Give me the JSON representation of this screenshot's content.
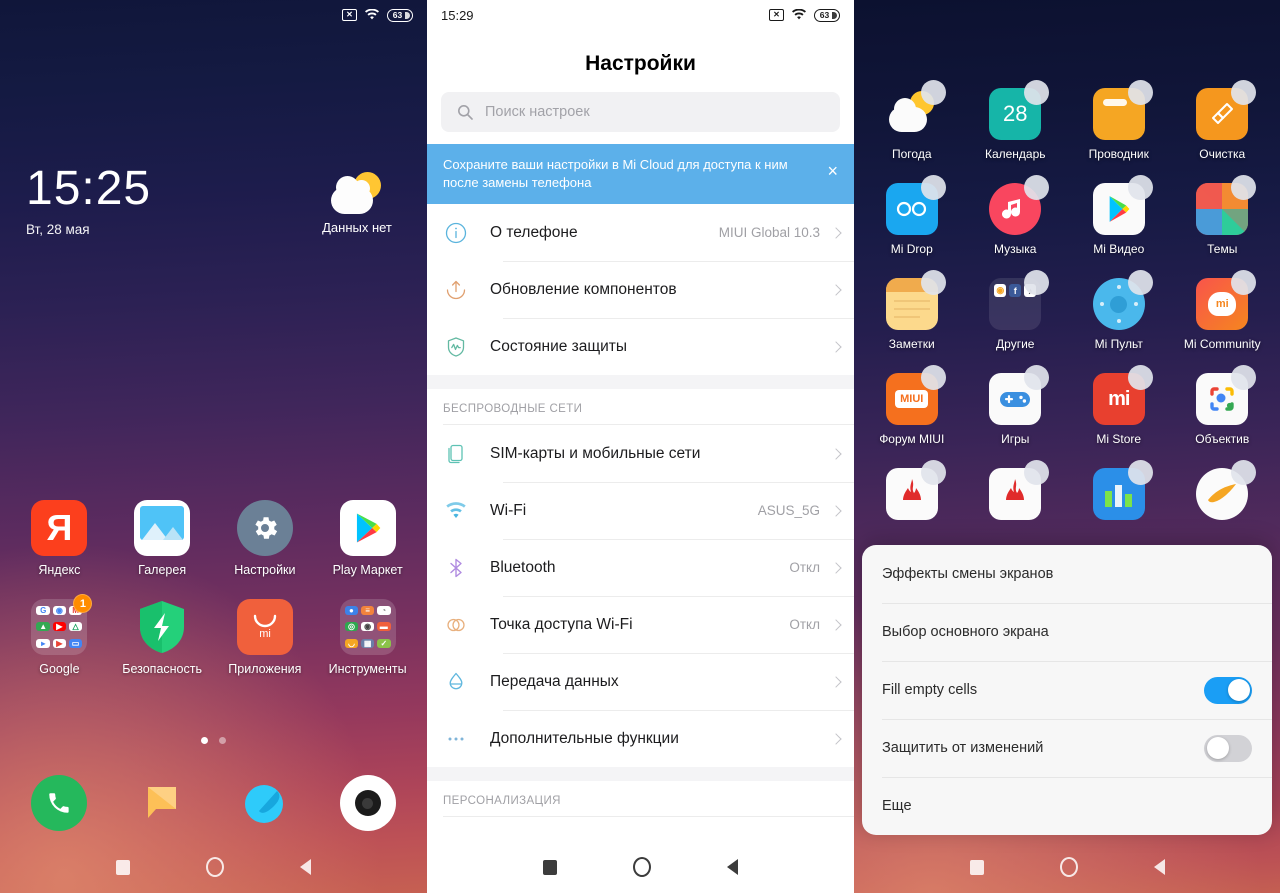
{
  "home": {
    "statusbar": {
      "icons": [
        "no-sim-icon",
        "wifi-icon",
        "battery-icon"
      ],
      "battery": "63"
    },
    "clock": {
      "time": "15:25",
      "date": "Вт, 28 мая"
    },
    "weather": {
      "label": "Данных нет",
      "icon": "sun-cloud-icon"
    },
    "apps": [
      {
        "label": "Яндекс",
        "icon": "yandex-icon"
      },
      {
        "label": "Галерея",
        "icon": "gallery-icon"
      },
      {
        "label": "Настройки",
        "icon": "settings-gear-icon"
      },
      {
        "label": "Play Маркет",
        "icon": "play-store-icon"
      },
      {
        "label": "Google",
        "icon": "google-folder-icon",
        "badge": "1"
      },
      {
        "label": "Безопасность",
        "icon": "security-shield-icon"
      },
      {
        "label": "Приложения",
        "icon": "mi-apps-icon"
      },
      {
        "label": "Инструменты",
        "icon": "tools-folder-icon"
      }
    ],
    "page_dots": {
      "count": 2,
      "active": 0
    },
    "dock": [
      {
        "label": "phone",
        "icon": "phone-icon"
      },
      {
        "label": "messages",
        "icon": "messages-icon"
      },
      {
        "label": "browser",
        "icon": "browser-icon"
      },
      {
        "label": "camera",
        "icon": "camera-icon"
      }
    ],
    "navbar": {
      "recent": "recents-icon",
      "home": "home-icon",
      "back": "back-icon"
    }
  },
  "settings": {
    "statusbar": {
      "time": "15:29",
      "battery": "63"
    },
    "title": "Настройки",
    "search": {
      "placeholder": "Поиск настроек",
      "icon": "search-icon"
    },
    "banner": {
      "text": "Сохраните ваши настройки в Mi Cloud для доступа к ним после замены телефона",
      "close": "×",
      "color": "#5cb0ea"
    },
    "group1": [
      {
        "label": "О телефоне",
        "value": "MIUI Global 10.3",
        "icon": "info-icon"
      },
      {
        "label": "Обновление компонентов",
        "value": "",
        "icon": "update-arrow-icon"
      },
      {
        "label": "Состояние защиты",
        "value": "",
        "icon": "shield-pulse-icon"
      }
    ],
    "section_wireless": "БЕСПРОВОДНЫЕ СЕТИ",
    "group2": [
      {
        "label": "SIM-карты и мобильные сети",
        "value": "",
        "icon": "sim-card-icon"
      },
      {
        "label": "Wi-Fi",
        "value": "ASUS_5G",
        "icon": "wifi-icon"
      },
      {
        "label": "Bluetooth",
        "value": "Откл",
        "icon": "bluetooth-icon"
      },
      {
        "label": "Точка доступа Wi-Fi",
        "value": "Откл",
        "icon": "hotspot-icon"
      },
      {
        "label": "Передача данных",
        "value": "",
        "icon": "data-usage-icon"
      },
      {
        "label": "Дополнительные функции",
        "value": "",
        "icon": "more-dots-icon"
      }
    ],
    "section_personalization": "ПЕРСОНАЛИЗАЦИЯ"
  },
  "drawer": {
    "apps": [
      {
        "label": "Погода",
        "icon": "weather-icon"
      },
      {
        "label": "Календарь",
        "icon": "calendar-icon",
        "day": "28"
      },
      {
        "label": "Проводник",
        "icon": "file-explorer-icon"
      },
      {
        "label": "Очистка",
        "icon": "cleaner-brush-icon"
      },
      {
        "label": "Mi Drop",
        "icon": "mi-drop-icon"
      },
      {
        "label": "Музыка",
        "icon": "music-note-icon"
      },
      {
        "label": "Mi Видео",
        "icon": "mi-video-icon"
      },
      {
        "label": "Темы",
        "icon": "themes-icon"
      },
      {
        "label": "Заметки",
        "icon": "notes-icon"
      },
      {
        "label": "Другие",
        "icon": "others-folder-icon"
      },
      {
        "label": "Mi Пульт",
        "icon": "mi-remote-icon"
      },
      {
        "label": "Mi Community",
        "icon": "mi-community-icon"
      },
      {
        "label": "Форум MIUI",
        "icon": "miui-forum-icon",
        "text": "MIUI"
      },
      {
        "label": "Игры",
        "icon": "games-gamepad-icon"
      },
      {
        "label": "Mi Store",
        "icon": "mi-store-icon"
      },
      {
        "label": "Объектив",
        "icon": "google-lens-icon"
      }
    ],
    "partial_row": [
      {
        "icon": "fire-app-icon"
      },
      {
        "icon": "fire-app-icon"
      },
      {
        "icon": "chart-app-icon"
      },
      {
        "icon": "boomerang-app-icon"
      }
    ],
    "popup": {
      "rows": [
        {
          "label": "Эффекты смены экранов",
          "type": "link"
        },
        {
          "label": "Выбор основного экрана",
          "type": "link"
        },
        {
          "label": "Fill empty cells",
          "type": "toggle",
          "state": "on"
        },
        {
          "label": "Защитить от изменений",
          "type": "toggle",
          "state": "off"
        },
        {
          "label": "Еще",
          "type": "link"
        }
      ],
      "accent": "#1a9ef5"
    }
  }
}
